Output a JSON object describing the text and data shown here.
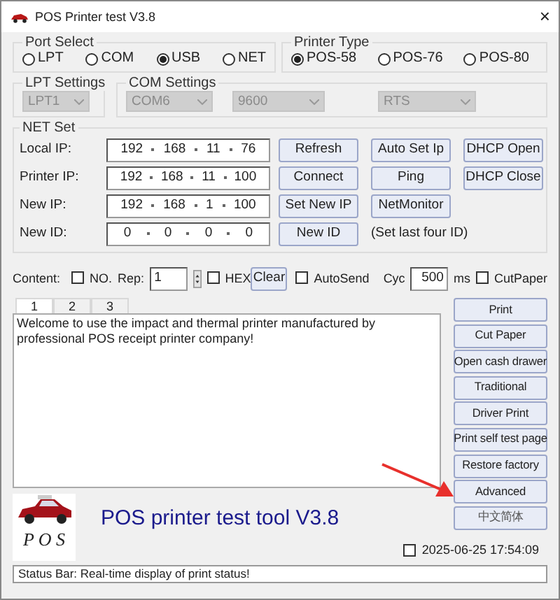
{
  "window": {
    "title": "POS Printer test V3.8",
    "close": "×"
  },
  "port_select": {
    "title": "Port Select",
    "options": [
      {
        "label": "LPT",
        "selected": false
      },
      {
        "label": "COM",
        "selected": false
      },
      {
        "label": "USB",
        "selected": true
      },
      {
        "label": "NET",
        "selected": false
      }
    ]
  },
  "printer_type": {
    "title": "Printer Type",
    "options": [
      {
        "label": "POS-58",
        "selected": true
      },
      {
        "label": "POS-76",
        "selected": false
      },
      {
        "label": "POS-80",
        "selected": false
      }
    ]
  },
  "lpt_settings": {
    "title": "LPT Settings",
    "selects": [
      {
        "value": "LPT1",
        "disabled": true
      }
    ]
  },
  "com_settings": {
    "title": "COM Settings",
    "selects": [
      {
        "value": "COM6",
        "disabled": true
      },
      {
        "value": "9600",
        "disabled": true
      },
      {
        "value": "RTS",
        "disabled": true
      }
    ]
  },
  "net_set": {
    "title": "NET Set",
    "rows": [
      {
        "label": "Local IP:",
        "octets": [
          "192",
          "168",
          "11",
          "76"
        ],
        "actions": [
          {
            "kind": "button",
            "label": "Refresh"
          },
          {
            "kind": "button",
            "label": "Auto Set Ip"
          },
          {
            "kind": "button",
            "label": "DHCP Open"
          }
        ]
      },
      {
        "label": "Printer IP:",
        "octets": [
          "192",
          "168",
          "11",
          "100"
        ],
        "actions": [
          {
            "kind": "button",
            "label": "Connect"
          },
          {
            "kind": "button",
            "label": "Ping"
          },
          {
            "kind": "button",
            "label": "DHCP Close"
          }
        ]
      },
      {
        "label": "New IP:",
        "octets": [
          "192",
          "168",
          "1",
          "100"
        ],
        "actions": [
          {
            "kind": "button",
            "label": "Set New IP"
          },
          {
            "kind": "button",
            "label": "NetMonitor"
          }
        ]
      },
      {
        "label": "New ID:",
        "octets": [
          "0",
          "0",
          "0",
          "0"
        ],
        "actions": [
          {
            "kind": "button",
            "label": "New ID"
          },
          {
            "kind": "note",
            "label": "(Set last four ID)"
          }
        ]
      }
    ]
  },
  "content_bar": {
    "content_label": "Content:",
    "no": {
      "label": "NO.",
      "checked": false
    },
    "rep_label": "Rep:",
    "rep_value": "1",
    "hex": {
      "label": "HEX",
      "checked": false
    },
    "clear": "Clear",
    "autosend": {
      "label": "AutoSend",
      "checked": false
    },
    "cyc_label": "Cyc",
    "cyc_value": "500",
    "ms_label": "ms",
    "cutpaper": {
      "label": "CutPaper",
      "checked": false
    }
  },
  "tabs": [
    {
      "label": "1",
      "selected": true
    },
    {
      "label": "2",
      "selected": false
    },
    {
      "label": "3",
      "selected": false
    }
  ],
  "editor_text": "Welcome to use the impact and thermal printer manufactured by professional POS receipt printer company!",
  "side_buttons": [
    "Print",
    "Cut Paper",
    "Open cash drawer",
    "Traditional",
    "Driver Print",
    "Print self test page",
    "Restore factory",
    "Advanced",
    "中文简体"
  ],
  "logo": {
    "text": "P O S"
  },
  "app_title": "POS printer test tool V3.8",
  "clock": {
    "checked": false,
    "text": "2025-06-25 17:54:09"
  },
  "status_bar": "Status Bar: Real-time display of print status!"
}
